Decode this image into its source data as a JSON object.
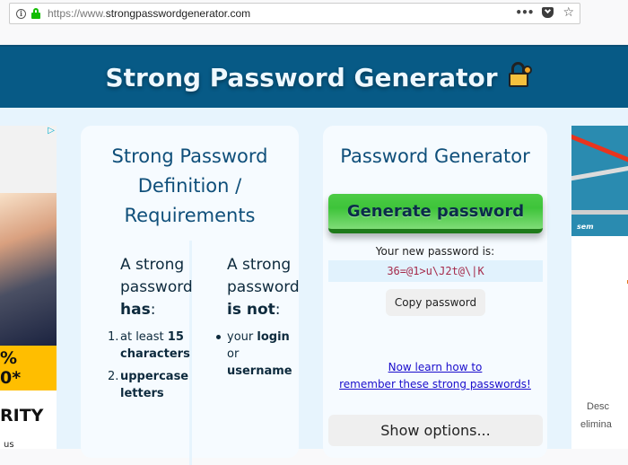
{
  "browser": {
    "url_prefix": "https://www.",
    "url_domain": "strongpasswordgenerator.com",
    "more_glyph": "•••",
    "star_glyph": "☆",
    "info_glyph": "i"
  },
  "header": {
    "title": "Strong Password Generator"
  },
  "definition_card": {
    "title": "Strong Password Definition / Requirements",
    "has_column": {
      "head_prefix": "A strong password",
      "head_bold": "has",
      "head_suffix": ":",
      "items": [
        {
          "num": "1.",
          "text": "at least",
          "bold": "15 characters"
        },
        {
          "num": "2.",
          "text": "",
          "bold": "uppercase letters"
        }
      ]
    },
    "not_column": {
      "head_prefix": "A strong password",
      "head_bold": "is not",
      "head_suffix": ":",
      "items": [
        {
          "text": "your",
          "bold": "login",
          "text2": "or",
          "bold2": "username"
        }
      ]
    }
  },
  "generator_card": {
    "title": "Password Generator",
    "generate_label": "Generate password",
    "new_password_label": "Your new password is:",
    "password": "36=@1>u\\J2t@\\|K",
    "copy_label": "Copy password",
    "learn_link_line1": "Now learn how to",
    "learn_link_line2": "remember these strong passwords!",
    "options_label": "Show options..."
  },
  "ads": {
    "left": {
      "choice_glyph": "▷",
      "yellow_line1": "%",
      "yellow_line2": "0*",
      "word": "RITY",
      "small": "us"
    },
    "right": {
      "logo": "sem",
      "desc_line1": "Desc",
      "desc_line2": "elimina"
    }
  }
}
